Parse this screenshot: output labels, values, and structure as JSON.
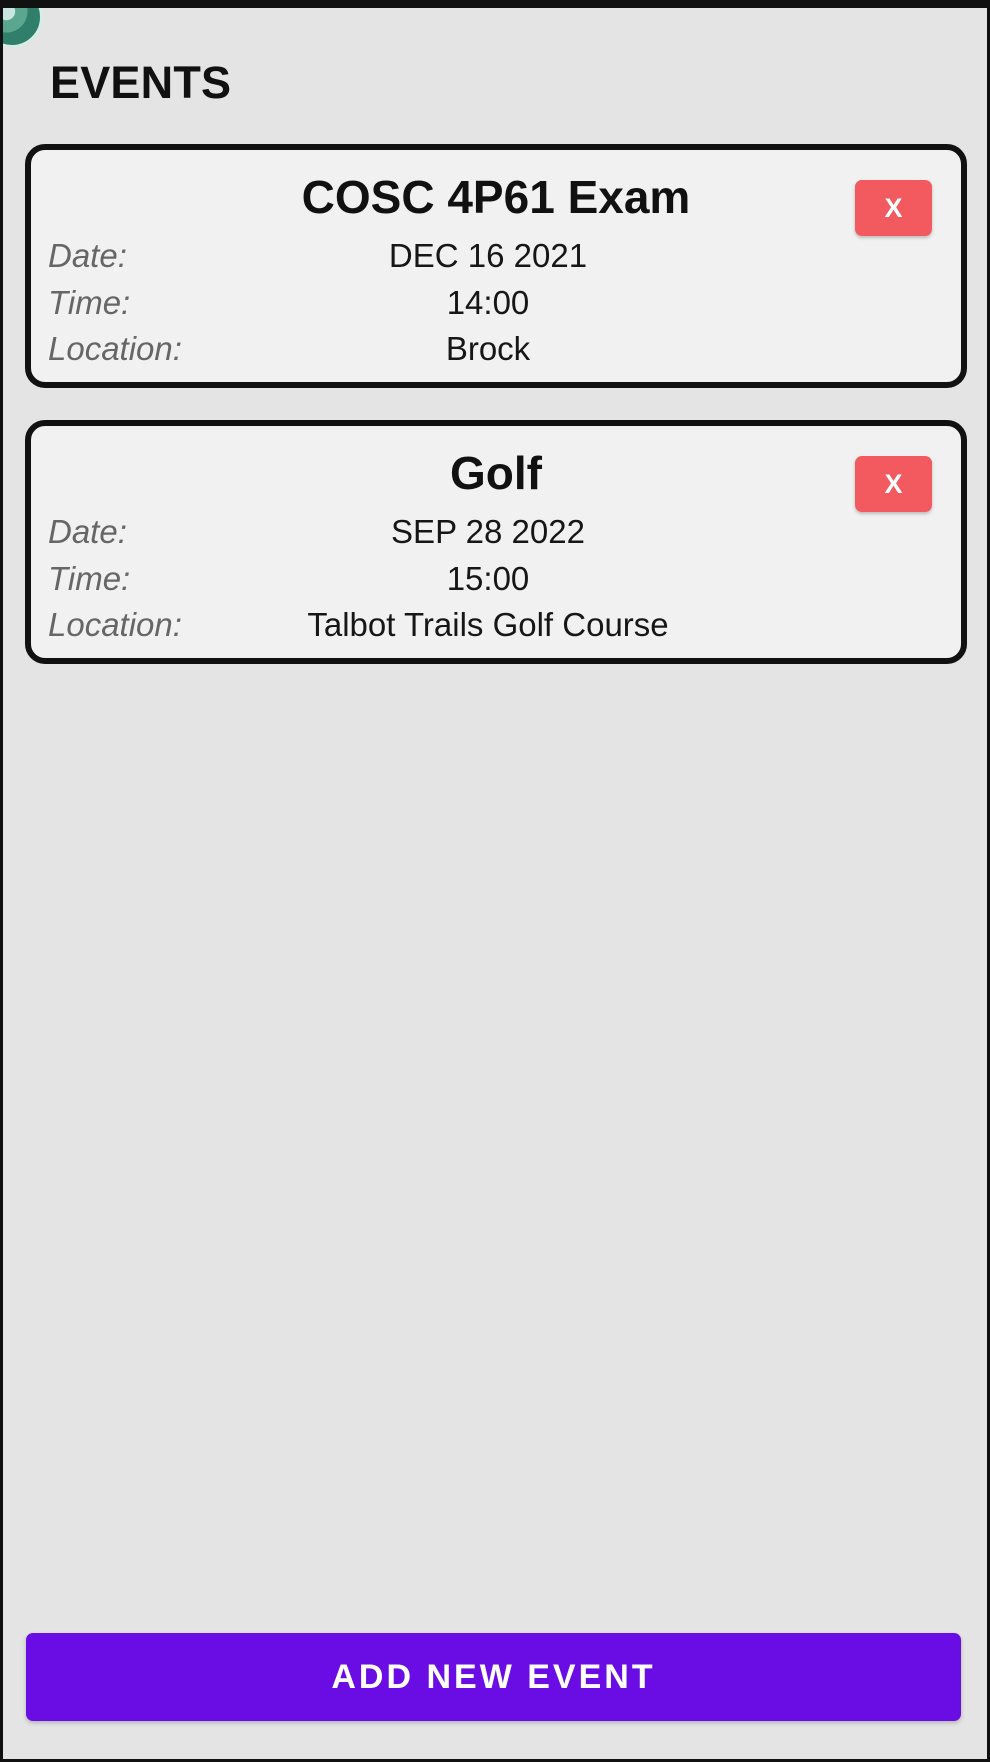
{
  "header": {
    "title": "EVENTS"
  },
  "events": [
    {
      "name": "COSC 4P61 Exam",
      "delete_label": "X",
      "date_label": "Date:",
      "date": "DEC 16 2021",
      "time_label": "Time:",
      "time": "14:00",
      "location_label": "Location:",
      "location": "Brock"
    },
    {
      "name": "Golf",
      "delete_label": "X",
      "date_label": "Date:",
      "date": "SEP 28 2022",
      "time_label": "Time:",
      "time": "15:00",
      "location_label": "Location:",
      "location": "Talbot Trails Golf Course"
    }
  ],
  "footer": {
    "add_event_label": "ADD NEW EVENT"
  },
  "colors": {
    "background": "#e4e4e4",
    "card_background": "#f1f1f1",
    "delete_button": "#f25a5f",
    "primary_button": "#6a0de5"
  }
}
